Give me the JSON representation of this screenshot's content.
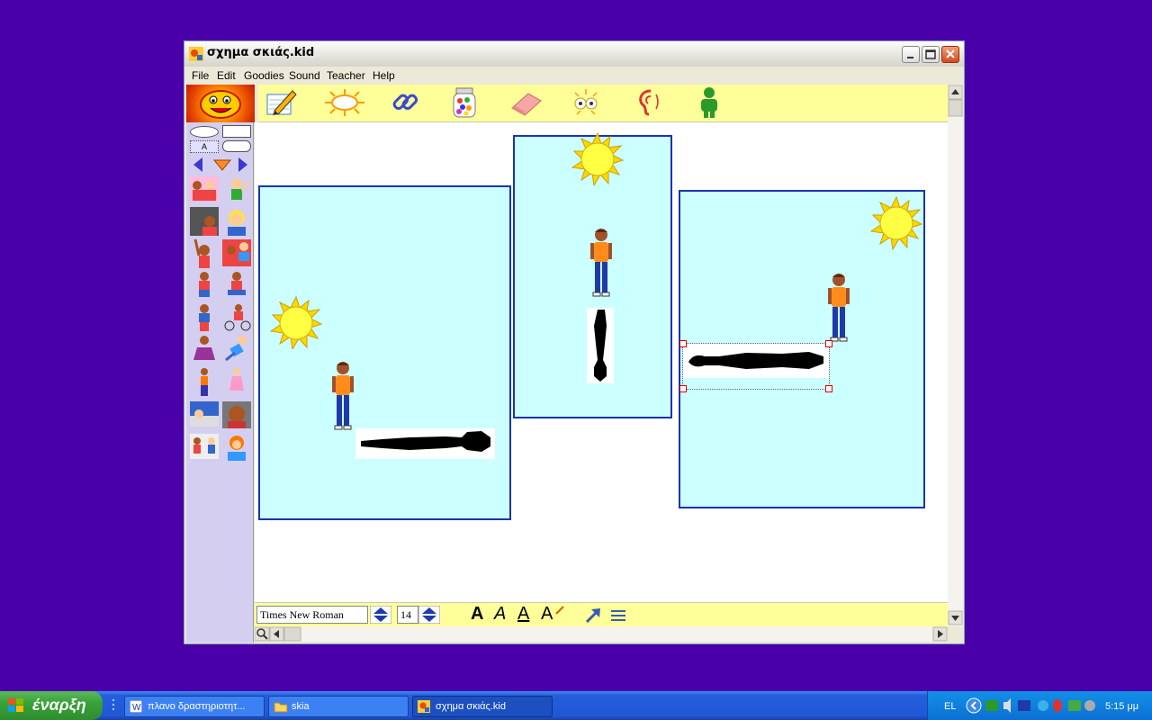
{
  "window": {
    "title": "σχημα σκιάς.kid"
  },
  "menu": [
    "File",
    "Edit",
    "Goodies",
    "Sound",
    "Teacher",
    "Help"
  ],
  "toolbar": {
    "tools": [
      "pencil-icon",
      "sun-burst-icon",
      "link-icon",
      "jar-icon",
      "eraser-icon",
      "face-effects-icon",
      "ear-icon",
      "person-icon"
    ]
  },
  "palette": {
    "shape_label": "A"
  },
  "textbar": {
    "font_name": "Times New Roman",
    "font_size": "14",
    "style_glyphs": [
      "A",
      "A",
      "A",
      "A"
    ]
  },
  "taskbar": {
    "start_label": "έναρξη",
    "tasks": [
      "πλανο δραστηριοτητ...",
      "skia",
      "σχημα σκιάς.kid"
    ],
    "language": "EL",
    "clock": "5:15 μμ"
  }
}
